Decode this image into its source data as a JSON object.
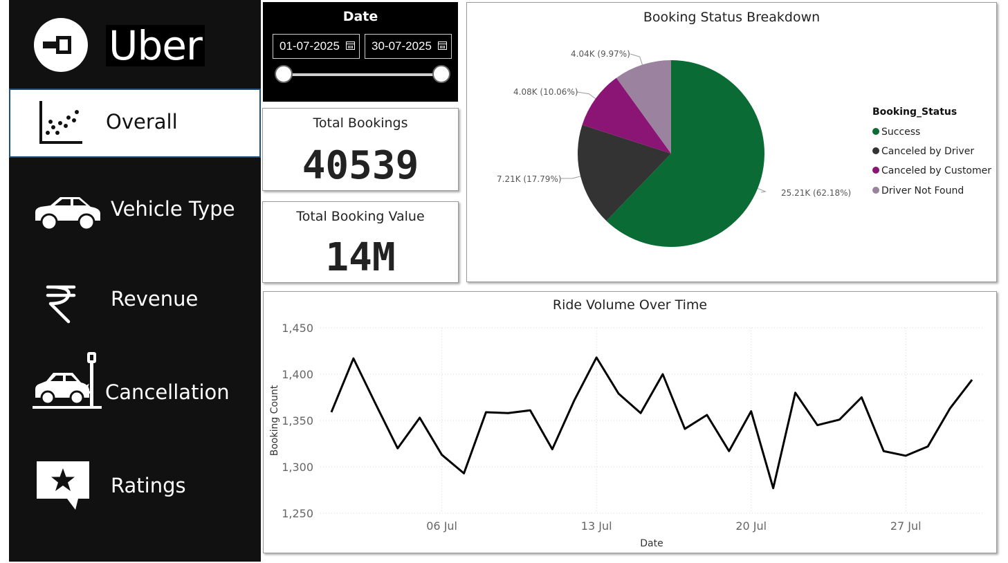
{
  "brand": {
    "name": "Uber"
  },
  "nav": [
    {
      "label": "Overall",
      "icon": "scatter-chart-icon",
      "active": true
    },
    {
      "label": "Vehicle Type",
      "icon": "car-icon"
    },
    {
      "label": "Revenue",
      "icon": "rupee-icon"
    },
    {
      "label": "Cancellation",
      "icon": "car-crash-icon"
    },
    {
      "label": "Ratings",
      "icon": "star-comment-icon"
    }
  ],
  "date_filter": {
    "title": "Date",
    "start": "01-07-2025",
    "end": "30-07-2025"
  },
  "kpis": {
    "total_bookings": {
      "title": "Total Bookings",
      "value": "40539"
    },
    "total_value": {
      "title": "Total Booking Value",
      "value": "14M"
    }
  },
  "colors": {
    "success": "#0b6b34",
    "canceled_driver": "#333333",
    "canceled_customer": "#8b1574",
    "not_found": "#9b83a0"
  },
  "chart_data": [
    {
      "type": "pie",
      "title": "Booking Status Breakdown",
      "legend_title": "Booking_Status",
      "legend_position": "right",
      "slices": [
        {
          "name": "Success",
          "value": 25.21,
          "label": "25.21K (62.18%)",
          "color": "#0b6b34"
        },
        {
          "name": "Canceled by Driver",
          "value": 7.21,
          "label": "7.21K (17.79%)",
          "color": "#333333"
        },
        {
          "name": "Canceled by Customer",
          "value": 4.08,
          "label": "4.08K (10.06%)",
          "color": "#8b1574"
        },
        {
          "name": "Driver Not Found",
          "value": 4.04,
          "label": "4.04K (9.97%)",
          "color": "#9b83a0"
        }
      ]
    },
    {
      "type": "line",
      "title": "Ride Volume Over Time",
      "xlabel": "Date",
      "ylabel": "Booking Count",
      "ylim": [
        1250,
        1450
      ],
      "yticks": [
        "1,250",
        "1,300",
        "1,350",
        "1,400",
        "1,450"
      ],
      "xticks": [
        {
          "day": 6,
          "label": "06 Jul"
        },
        {
          "day": 13,
          "label": "13 Jul"
        },
        {
          "day": 20,
          "label": "20 Jul"
        },
        {
          "day": 27,
          "label": "27 Jul"
        }
      ],
      "grid": true,
      "x": [
        1,
        2,
        3,
        4,
        5,
        6,
        7,
        8,
        9,
        10,
        11,
        12,
        13,
        14,
        15,
        16,
        17,
        18,
        19,
        20,
        21,
        22,
        23,
        24,
        25,
        26,
        27,
        28,
        29,
        30
      ],
      "values": [
        1359,
        1417,
        1368,
        1320,
        1353,
        1313,
        1293,
        1359,
        1358,
        1361,
        1319,
        1372,
        1418,
        1379,
        1358,
        1400,
        1341,
        1356,
        1317,
        1360,
        1277,
        1380,
        1345,
        1351,
        1375,
        1317,
        1312,
        1322,
        1363,
        1394
      ]
    }
  ]
}
